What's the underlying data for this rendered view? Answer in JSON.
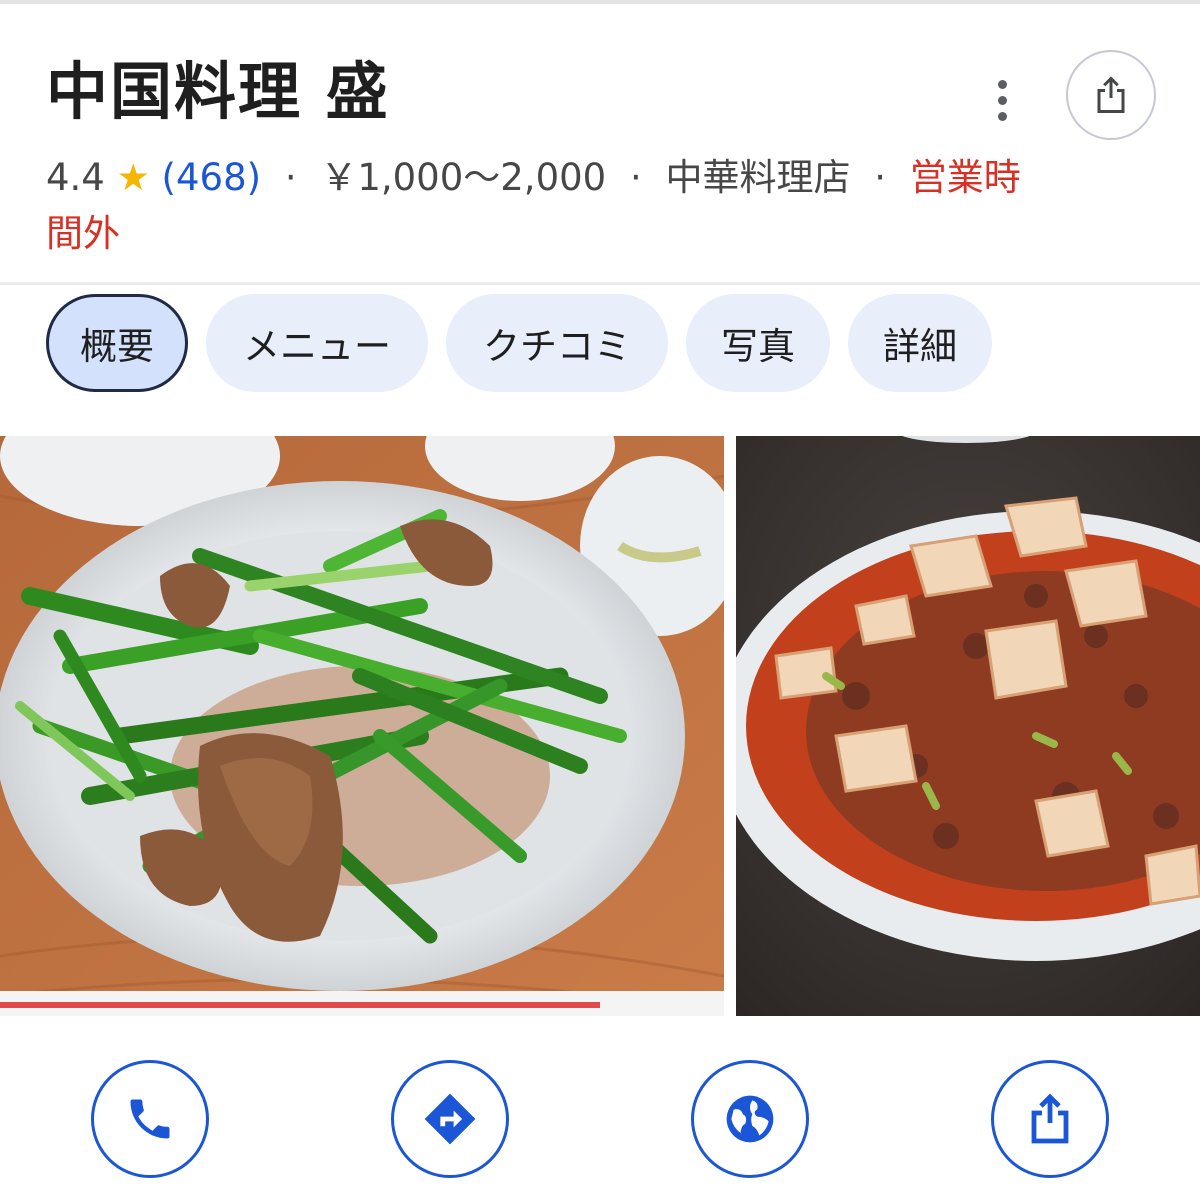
{
  "place": {
    "title": "中国料理 盛",
    "rating": "4.4",
    "star_glyph": "★",
    "review_count": "(468)",
    "price_range": "￥1,000〜2,000",
    "category": "中華料理店",
    "status": "営業時間外",
    "separator": "·"
  },
  "tabs": [
    {
      "label": "概要",
      "active": true
    },
    {
      "label": "メニュー",
      "active": false
    },
    {
      "label": "クチコミ",
      "active": false
    },
    {
      "label": "写真",
      "active": false
    },
    {
      "label": "詳細",
      "active": false
    }
  ],
  "header": {
    "more_icon": "more-vert-icon",
    "share_icon": "share-icon"
  },
  "actions": [
    {
      "icon": "phone-icon"
    },
    {
      "icon": "directions-icon"
    },
    {
      "icon": "globe-icon"
    },
    {
      "icon": "share-icon"
    }
  ],
  "colors": {
    "accent": "#1a56d6",
    "closed": "#d93025",
    "star": "#f6b500",
    "chip": "#e9eefb",
    "chip_active": "#d3e1fd"
  }
}
